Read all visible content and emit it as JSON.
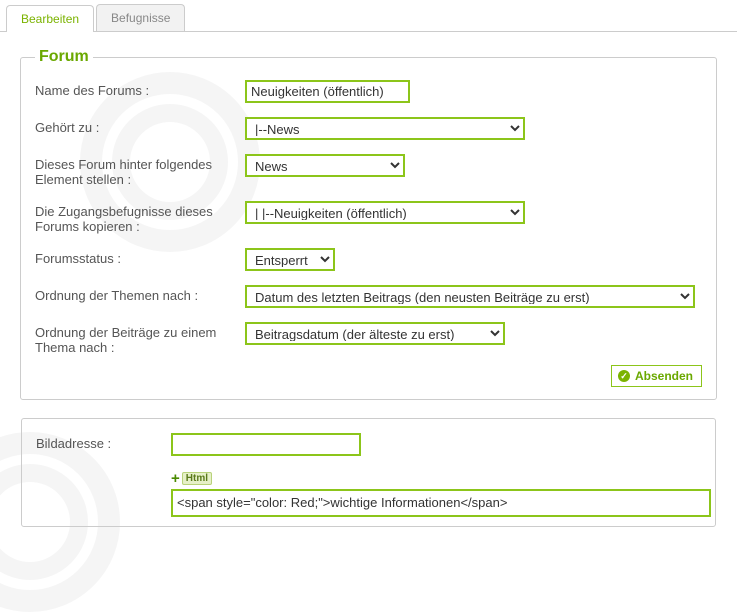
{
  "tabs": {
    "edit": "Bearbeiten",
    "perm": "Befugnisse"
  },
  "legend": "Forum",
  "labels": {
    "name": "Name des Forums :",
    "belong": "Gehört zu :",
    "after": "Dieses Forum hinter folgendes Element stellen :",
    "copy": "Die Zugangsbefugnisse dieses Forums kopieren :",
    "status": "Forumsstatus :",
    "torder": "Ordnung der Themen nach :",
    "porder": "Ordnung der Beiträge zu einem Thema nach :",
    "imgaddr": "Bildadresse :"
  },
  "values": {
    "name": "Neuigkeiten (öffentlich)",
    "belong": "|--News",
    "after": "News",
    "copy": "|   |--Neuigkeiten (öffentlich)",
    "status": "Entsperrt",
    "torder": "Datum des letzten Beitrags (den neusten Beiträge zu erst)",
    "porder": "Beitragsdatum (der älteste zu erst)",
    "imgaddr": "",
    "html": "<span style=\"color: Red;\">wichtige Informationen</span>"
  },
  "buttons": {
    "send": "Absenden",
    "htmlbadge": "Html"
  }
}
